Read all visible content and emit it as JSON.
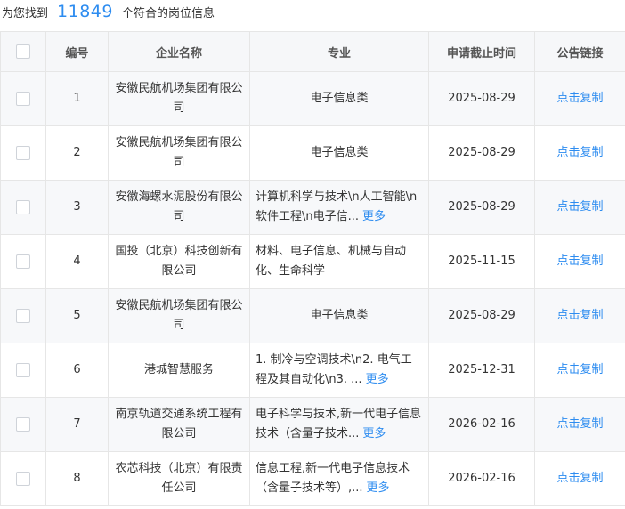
{
  "summary": {
    "prefix": "为您找到",
    "count": "11849",
    "suffix": "个符合的岗位信息"
  },
  "table": {
    "headers": {
      "index": "编号",
      "company": "企业名称",
      "major": "专业",
      "deadline": "申请截止时间",
      "link": "公告链接"
    },
    "rows": [
      {
        "index": "1",
        "company": "安徽民航机场集团有限公司",
        "major": "电子信息类",
        "more": "",
        "deadline": "2025-08-29",
        "link": "点击复制"
      },
      {
        "index": "2",
        "company": "安徽民航机场集团有限公司",
        "major": "电子信息类",
        "more": "",
        "deadline": "2025-08-29",
        "link": "点击复制"
      },
      {
        "index": "3",
        "company": "安徽海螺水泥股份有限公司",
        "major": "计算机科学与技术\\n人工智能\\n软件工程\\n电子信...",
        "more": "更多",
        "deadline": "2025-08-29",
        "link": "点击复制"
      },
      {
        "index": "4",
        "company": "国投（北京）科技创新有限公司",
        "major": "材料、电子信息、机械与自动化、生命科学",
        "more": "",
        "deadline": "2025-11-15",
        "link": "点击复制"
      },
      {
        "index": "5",
        "company": "安徽民航机场集团有限公司",
        "major": "电子信息类",
        "more": "",
        "deadline": "2025-08-29",
        "link": "点击复制"
      },
      {
        "index": "6",
        "company": "港城智慧服务",
        "major": "1. 制冷与空调技术\\n2. 电气工程及其自动化\\n3. ...",
        "more": "更多",
        "deadline": "2025-12-31",
        "link": "点击复制"
      },
      {
        "index": "7",
        "company": "南京轨道交通系统工程有限公司",
        "major": "电子科学与技术,新一代电子信息技术（含量子技术...",
        "more": "更多",
        "deadline": "2026-02-16",
        "link": "点击复制"
      },
      {
        "index": "8",
        "company": "农芯科技（北京）有限责任公司",
        "major": "信息工程,新一代电子信息技术（含量子技术等）,...",
        "more": "更多",
        "deadline": "2026-02-16",
        "link": "点击复制"
      }
    ]
  }
}
